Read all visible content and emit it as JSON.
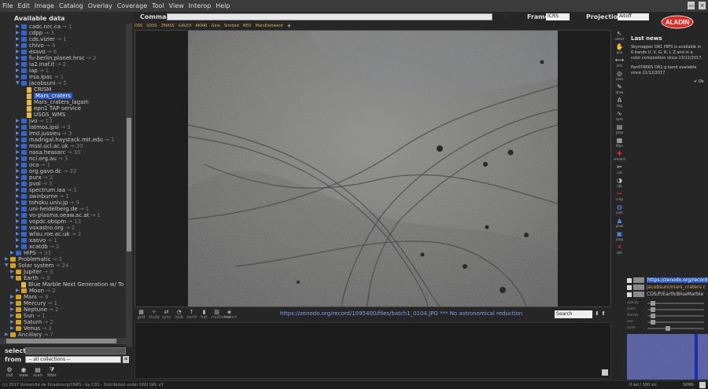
{
  "menubar": {
    "items": [
      "File",
      "Edit",
      "Image",
      "Catalog",
      "Overlay",
      "Coverage",
      "Tool",
      "View",
      "Interop",
      "Help"
    ]
  },
  "tree": {
    "header": "Available data",
    "nodes": [
      {
        "label": "cadc.nrc.ca",
        "count": "→ 1",
        "level": 2,
        "kind": "folder",
        "open": false
      },
      {
        "label": "cdpp",
        "count": "→ 3",
        "level": 2,
        "kind": "folder",
        "open": false
      },
      {
        "label": "cds.vizier",
        "count": "→ 1",
        "level": 2,
        "kind": "folder",
        "open": false
      },
      {
        "label": "chivo",
        "count": "→ 4",
        "level": 2,
        "kind": "folder",
        "open": false
      },
      {
        "label": "esavo",
        "count": "→ 6",
        "level": 2,
        "kind": "folder",
        "open": false
      },
      {
        "label": "fu-berlin.planet.hrsc",
        "count": "→ 2",
        "level": 2,
        "kind": "folder",
        "open": false
      },
      {
        "label": "ia2.inaf.it",
        "count": "→ 2",
        "level": 2,
        "kind": "folder",
        "open": false
      },
      {
        "label": "iap",
        "count": "→ 1",
        "level": 2,
        "kind": "folder",
        "open": false
      },
      {
        "label": "irsa.ipac",
        "count": "→ 1",
        "level": 2,
        "kind": "folder",
        "open": false
      },
      {
        "label": "jacobsuni",
        "count": "→ 5",
        "level": 2,
        "kind": "folder",
        "open": true
      },
      {
        "label": "CRISM",
        "count": "",
        "level": 3,
        "kind": "doc",
        "open": false
      },
      {
        "label": "Mars_craters",
        "count": "",
        "level": 3,
        "kind": "doc",
        "open": false,
        "selected": true
      },
      {
        "label": "Mars_craters_lagain",
        "count": "",
        "level": 3,
        "kind": "doc",
        "open": false
      },
      {
        "label": "epn1 TAP service",
        "count": "",
        "level": 3,
        "kind": "doc",
        "open": false
      },
      {
        "label": "USGS_WMS",
        "count": "",
        "level": 3,
        "kind": "doc",
        "open": false
      },
      {
        "label": "jvo",
        "count": "→ 13",
        "level": 2,
        "kind": "folder",
        "open": false
      },
      {
        "label": "latmos.ipsl",
        "count": "→ 3",
        "level": 2,
        "kind": "folder",
        "open": false
      },
      {
        "label": "lmd.jussieu",
        "count": "→ 3",
        "level": 2,
        "kind": "folder",
        "open": false
      },
      {
        "label": "madrigal.haystack.mit.edu",
        "count": "→ 1",
        "level": 2,
        "kind": "folder",
        "open": false
      },
      {
        "label": "mssl.ucl.ac.uk",
        "count": "→ 30",
        "level": 2,
        "kind": "folder",
        "open": false
      },
      {
        "label": "nasa.heasarc",
        "count": "→ 30",
        "level": 2,
        "kind": "folder",
        "open": false
      },
      {
        "label": "ncl.org.au",
        "count": "→ 3",
        "level": 2,
        "kind": "folder",
        "open": false
      },
      {
        "label": "oca",
        "count": "→ 1",
        "level": 2,
        "kind": "folder",
        "open": false
      },
      {
        "label": "org.gavo.dc",
        "count": "→ 33",
        "level": 2,
        "kind": "folder",
        "open": false
      },
      {
        "label": "purx",
        "count": "→ 2",
        "level": 2,
        "kind": "folder",
        "open": false
      },
      {
        "label": "pvol",
        "count": "→ 3",
        "level": 2,
        "kind": "folder",
        "open": false
      },
      {
        "label": "spectrum.iaa",
        "count": "→ 3",
        "level": 2,
        "kind": "folder",
        "open": false
      },
      {
        "label": "swinburne",
        "count": "→ 1",
        "level": 2,
        "kind": "folder",
        "open": false
      },
      {
        "label": "tohoku.univ.jp",
        "count": "→ 9",
        "level": 2,
        "kind": "folder",
        "open": false
      },
      {
        "label": "uni-heidelberg.de",
        "count": "→ 1",
        "level": 2,
        "kind": "folder",
        "open": false
      },
      {
        "label": "vo-plasma.oeaw.ac.at",
        "count": "→ 1",
        "level": 2,
        "kind": "folder",
        "open": false
      },
      {
        "label": "vopdc.obspm",
        "count": "→ 13",
        "level": 2,
        "kind": "folder",
        "open": false
      },
      {
        "label": "voxastro.org",
        "count": "→ 2",
        "level": 2,
        "kind": "folder",
        "open": false
      },
      {
        "label": "wfau.roe.ac.uk",
        "count": "→ 2",
        "level": 2,
        "kind": "folder",
        "open": false
      },
      {
        "label": "xaovo",
        "count": "→ 1",
        "level": 2,
        "kind": "folder",
        "open": false
      },
      {
        "label": "xcatdb",
        "count": "→ 2",
        "level": 2,
        "kind": "folder",
        "open": false
      },
      {
        "label": "HiPS",
        "count": "→ 33",
        "level": 1,
        "kind": "folder",
        "open": false
      },
      {
        "label": "Problematic",
        "count": "→ 3",
        "level": 0,
        "kind": "yfolder",
        "open": false
      },
      {
        "label": "Solar system",
        "count": "→ 24",
        "level": 0,
        "kind": "yfolder",
        "open": true
      },
      {
        "label": "Jupiter",
        "count": "→ 3",
        "level": 1,
        "kind": "yfolder",
        "open": false
      },
      {
        "label": "Earth",
        "count": "→ 3",
        "level": 1,
        "kind": "yfolder",
        "open": true
      },
      {
        "label": "Blue Marble Next Generation w/ To",
        "count": "",
        "level": 2,
        "kind": "doc",
        "open": false
      },
      {
        "label": "Moon",
        "count": "→ 2",
        "level": 2,
        "kind": "yfolder",
        "open": false
      },
      {
        "label": "Mars",
        "count": "→ 9",
        "level": 1,
        "kind": "yfolder",
        "open": false
      },
      {
        "label": "Mercury",
        "count": "→ 1",
        "level": 1,
        "kind": "yfolder",
        "open": false
      },
      {
        "label": "Neptune",
        "count": "→ 2",
        "level": 1,
        "kind": "yfolder",
        "open": false
      },
      {
        "label": "Sun",
        "count": "→ 1",
        "level": 1,
        "kind": "yfolder",
        "open": false
      },
      {
        "label": "Saturn",
        "count": "→ 2",
        "level": 1,
        "kind": "yfolder",
        "open": false
      },
      {
        "label": "Venus",
        "count": "→ 3",
        "level": 1,
        "kind": "yfolder",
        "open": false
      },
      {
        "label": "Ancillary",
        "count": "→ 7",
        "level": 0,
        "kind": "yfolder",
        "open": false
      }
    ]
  },
  "select": {
    "label": "select",
    "value": ""
  },
  "from": {
    "label": "from",
    "value": "-- all collections --",
    "button": "≡"
  },
  "bottom_tools": [
    {
      "icon": "coll",
      "label": "coll"
    },
    {
      "icon": "view",
      "label": "view"
    },
    {
      "icon": "scan",
      "label": "scan"
    },
    {
      "icon": "filter",
      "label": "filter"
    }
  ],
  "command": {
    "label": "Command",
    "value": "",
    "clear": "×"
  },
  "frame": {
    "label": "Frame",
    "value": "ICRS"
  },
  "projection": {
    "label": "Projection",
    "value": "Aitoff"
  },
  "logo_text": "ALADIN",
  "surveys": [
    "DSS",
    "SDSS",
    "2MASS",
    "GALEX",
    "AKARI",
    "Gaia",
    "Simbad",
    "NED",
    "MarsEastward",
    "+"
  ],
  "view_tools": [
    {
      "label": "grid"
    },
    {
      "label": "study"
    },
    {
      "label": "sync"
    },
    {
      "label": "look"
    },
    {
      "label": "north"
    },
    {
      "label": "hdr"
    },
    {
      "label": "multiview"
    },
    {
      "label": "match"
    }
  ],
  "view": {
    "url_text": "https://zenodo.org/record/1095400/files/batch1_0104.JPG *** No astronomical reduction",
    "search_value": "Search",
    "nav_prev": "⬇",
    "nav_next": "⬆"
  },
  "right_tools": [
    {
      "label": "select",
      "icon": "select-arrow-icon",
      "glyph": "↖",
      "color": ""
    },
    {
      "label": "pan",
      "icon": "pan-hand-icon",
      "glyph": "✋",
      "color": ""
    },
    {
      "label": "dist",
      "icon": "dist-icon",
      "glyph": "⟷",
      "color": ""
    },
    {
      "label": "phot",
      "icon": "phot-icon",
      "glyph": "◎",
      "color": ""
    },
    {
      "label": "draw",
      "icon": "draw-pencil-icon",
      "glyph": "✎",
      "color": ""
    },
    {
      "label": "tag",
      "icon": "tag-icon",
      "glyph": "A",
      "color": ""
    },
    {
      "label": "spec",
      "icon": "spec-icon",
      "glyph": "∿",
      "color": ""
    },
    {
      "label": "prop",
      "icon": "prop-icon",
      "glyph": "▤",
      "color": ""
    },
    {
      "label": "filter",
      "icon": "filter-icon",
      "glyph": "▦",
      "color": ""
    },
    {
      "label": "xmatch",
      "icon": "xmatch-icon",
      "glyph": "✚",
      "color": "red"
    },
    {
      "label": "cut",
      "icon": "cut-icon",
      "glyph": "✂",
      "color": ""
    },
    {
      "label": "rgb",
      "icon": "rgb-icon",
      "glyph": "◑",
      "color": ""
    },
    {
      "label": "crop",
      "icon": "crop-icon",
      "glyph": "✂",
      "color": "red"
    },
    {
      "label": "cont",
      "icon": "contour-icon",
      "glyph": "◍",
      "color": "blue"
    },
    {
      "label": "pixel",
      "icon": "pixel-icon",
      "glyph": "▲",
      "color": "blue"
    },
    {
      "label": "prop",
      "icon": "prop-panel-icon",
      "glyph": "▣",
      "color": "blue"
    },
    {
      "label": "del",
      "icon": "delete-icon",
      "glyph": "✕",
      "color": "red"
    }
  ],
  "news": {
    "title": "Last news",
    "items": [
      "Skymapper DR1 HIPS is available in 6 bands U, V, G, R, I, Z and in a color composition since 13/12/2017.",
      "PanSTARRS DR1 g band available since 21/12/2017"
    ],
    "ok": "Ok"
  },
  "stack": [
    {
      "label": "https://zenodo.org/record",
      "style": "sel"
    },
    {
      "label": "jacobsuni/mars_craters c",
      "style": "yel"
    },
    {
      "label": "CDS/P/Earth/BlueMarble",
      "style": ""
    }
  ],
  "sliders": [
    {
      "name": "opacity",
      "value": 0.05
    },
    {
      "name": "zoom",
      "value": 0.05
    },
    {
      "name": "density",
      "value": 0.05
    },
    {
      "name": "size",
      "value": 0.05
    },
    {
      "name": "zoom",
      "value": 0.32
    }
  ],
  "status": {
    "copyright": "(c) 2017 Université de Strasbourg/CNRS - by CDS - Distributed under GNU GPL v3",
    "mem": "0 sel / 100 src",
    "mem2": "50Mb"
  },
  "colors": {
    "selected": "#2a57b8",
    "folder_blue": "#3366cc",
    "folder_yellow": "#d6a21e",
    "accent_red": "#d03a2a"
  }
}
